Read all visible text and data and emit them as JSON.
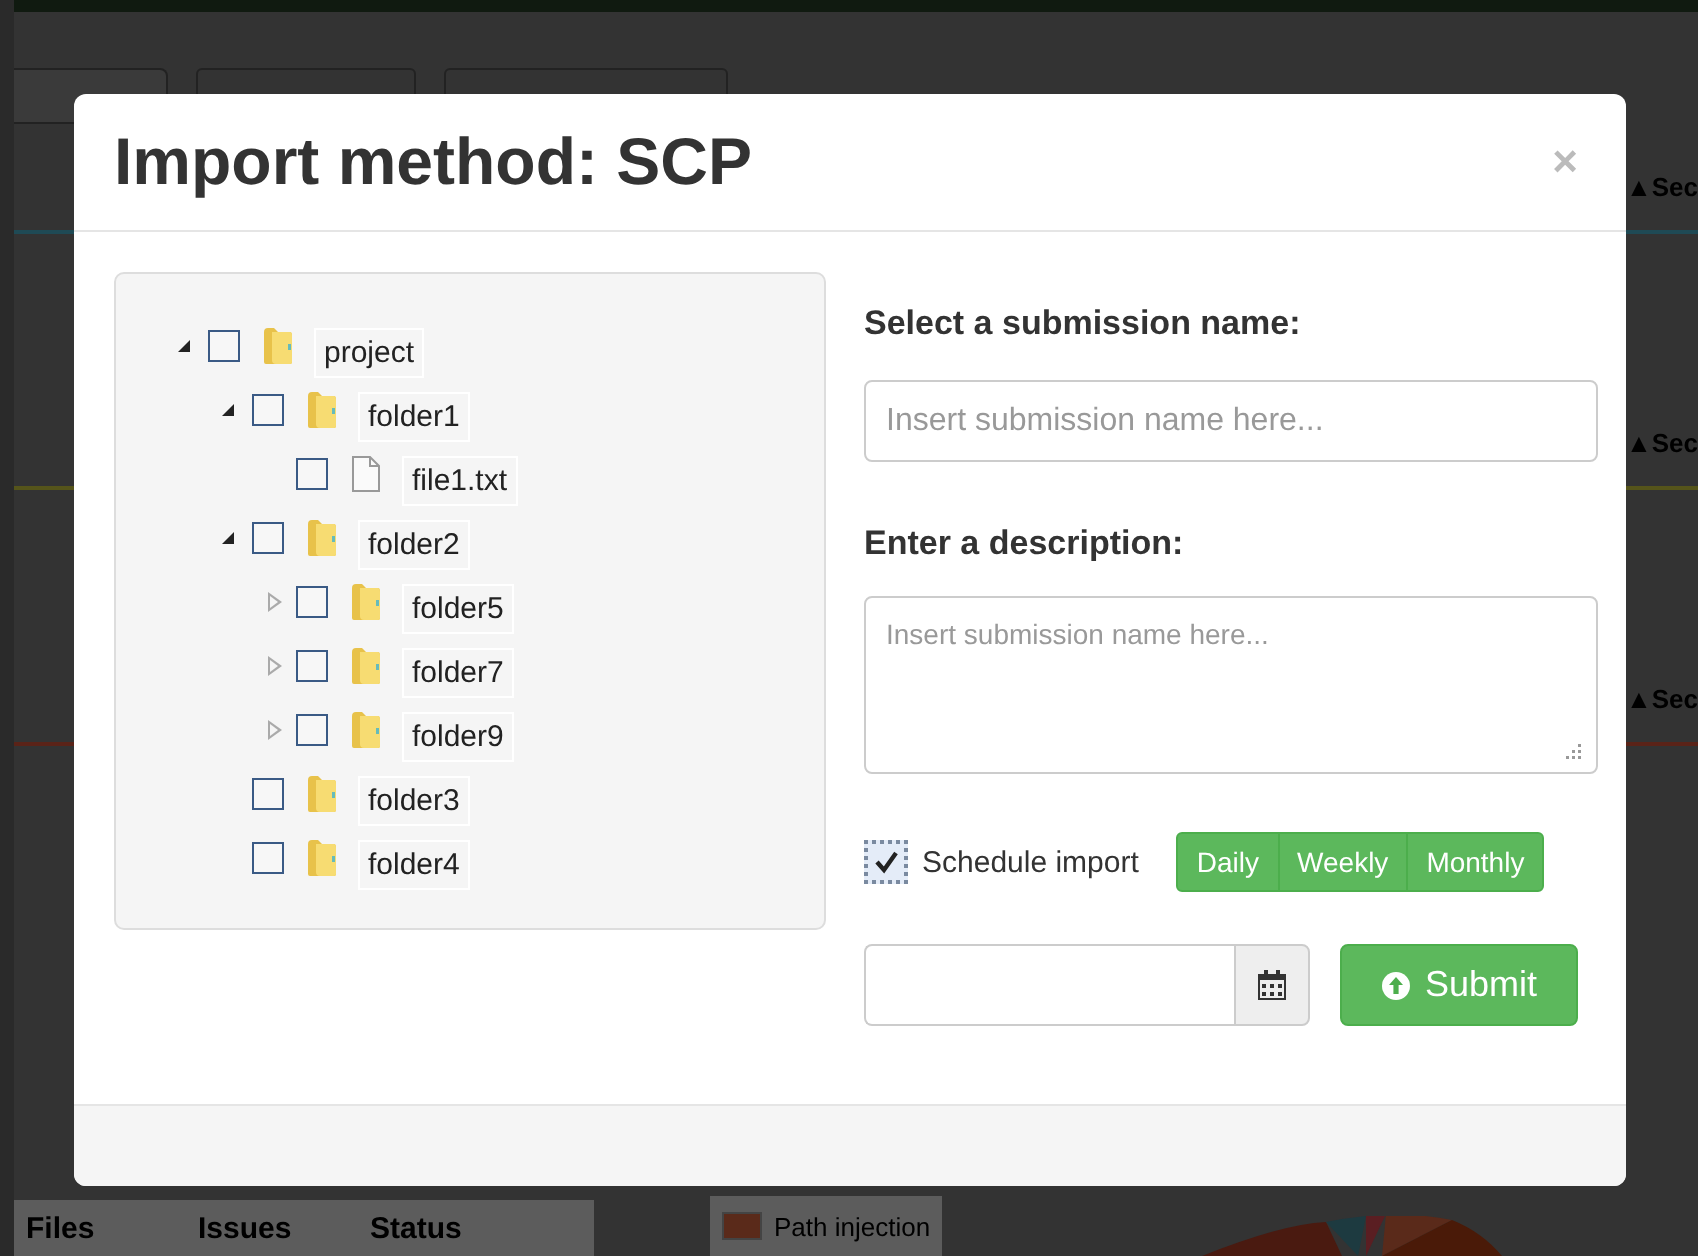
{
  "background": {
    "side_labels": [
      {
        "text": "▲Sec",
        "color": "#1f4a55"
      },
      {
        "text": "▲Sec",
        "color": "#55541a"
      },
      {
        "text": "▲Sec",
        "color": "#5a2318"
      }
    ],
    "table_headers": [
      "Files",
      "Issues",
      "Status"
    ],
    "legend": [
      {
        "label": "Path injection",
        "color": "#5a2a1a"
      }
    ]
  },
  "modal": {
    "title": "Import method: SCP",
    "close": "×",
    "tree": [
      {
        "label": "project",
        "kind": "folder",
        "expanded": true,
        "checked": false,
        "children": [
          {
            "label": "folder1",
            "kind": "folder",
            "expanded": true,
            "checked": false,
            "children": [
              {
                "label": "file1.txt",
                "kind": "file",
                "checked": false
              }
            ]
          },
          {
            "label": "folder2",
            "kind": "folder",
            "expanded": true,
            "checked": false,
            "children": [
              {
                "label": "folder5",
                "kind": "folder",
                "expanded": false,
                "checked": false
              },
              {
                "label": "folder7",
                "kind": "folder",
                "expanded": false,
                "checked": false
              },
              {
                "label": "folder9",
                "kind": "folder",
                "expanded": false,
                "checked": false
              }
            ]
          },
          {
            "label": "folder3",
            "kind": "folder",
            "checked": false
          },
          {
            "label": "folder4",
            "kind": "folder",
            "checked": false
          }
        ]
      }
    ],
    "name_label": "Select a submission name:",
    "name_placeholder": "Insert submission name here...",
    "description_label": "Enter a description:",
    "description_placeholder": "Insert submission name here...",
    "schedule": {
      "label": "Schedule import",
      "checked": true
    },
    "frequencies": [
      {
        "label": "Daily",
        "selected": false
      },
      {
        "label": "Weekly",
        "selected": false
      },
      {
        "label": "Monthly",
        "selected": false
      }
    ],
    "submit": "Submit"
  }
}
